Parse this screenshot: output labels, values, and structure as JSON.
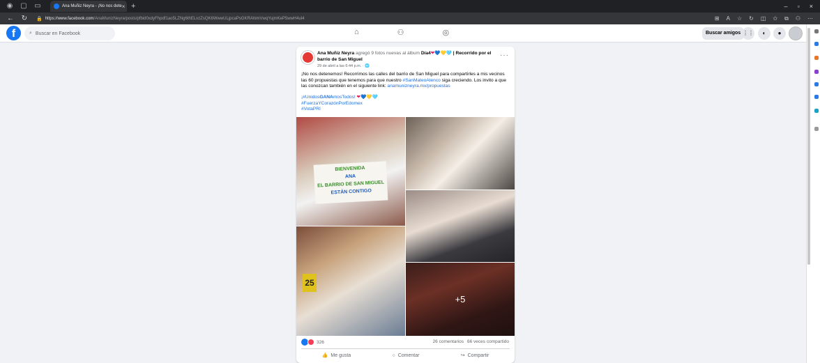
{
  "browser": {
    "tab_title": "Ana Muñiz Neyra - ¡No nos dete",
    "url_host": "https://www.facebook.com",
    "url_path": "/AnaMunizNeyra/posts/pfbid0xdyFhpdf1ao5LZNg6thELvzZsQK6WwwULjpcaPsGKRAhimVwqYujmKeP5wwH4ul4"
  },
  "fb": {
    "search_placeholder": "Buscar en Facebook",
    "find_friends": "Buscar amigos"
  },
  "post": {
    "author": "Ana Muñiz Neyra",
    "action": "agregó 9 fotos nuevas al álbum",
    "album_prefix": "Día4",
    "album_emoji": "❤💙💛🩵",
    "album_title": "| Recorrido por el barrio de San Miguel",
    "date": "29 de abril a las 6:44 p.m. · 🌐",
    "text_main": "¡No nos detenemos! Recorrimos las calles del barrio de San Miguel para compartirles a mis vecinos las 60 propuestas que tenemos para que nuestro",
    "text_hashtag": "#SanMateoAtenco",
    "text_mid": "siga creciendo. Los invito a que las conozcan también en el siguiente link:",
    "text_link": "anamunizneyra.mx/propuestas",
    "tag1_prefix": "¡#Unidos",
    "tag1_bold": "GANA",
    "tag1_suffix": "mosTodos!",
    "tag1_emoji": "❤💙💛🩵",
    "tag2": "#FuerzaYCorazónPorEdomex",
    "tag3": "#VotaPRI",
    "sign_lines": [
      "BIENVENIDA",
      "ANA",
      "EL BARRIO DE SAN MIGUEL",
      "ESTÁN CONTIGO"
    ],
    "photo_tag": "25",
    "more_photos": "+5",
    "reaction_count": "326",
    "comments": "26 comentarios",
    "shares": "66 veces compartido",
    "like_label": "Me gusta",
    "comment_label": "Comentar",
    "share_label": "Compartir"
  },
  "colors": {
    "fb_blue": "#1877f2",
    "link": "#216fdb"
  }
}
